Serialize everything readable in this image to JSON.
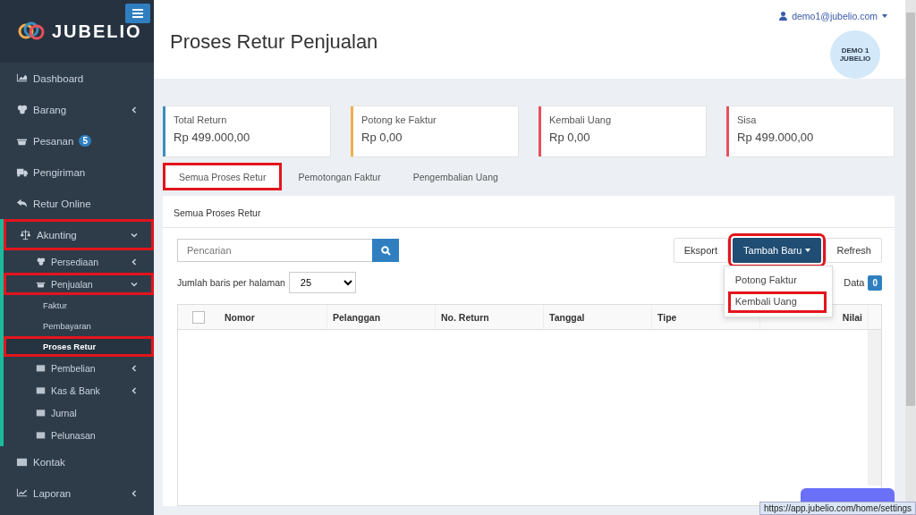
{
  "sidebar": {
    "brand": "JUBELIO",
    "items": [
      {
        "label": "Dashboard",
        "selected": false
      },
      {
        "label": "Barang",
        "selected": false,
        "expanded": false
      },
      {
        "label": "Pesanan",
        "selected": false,
        "badge": "5"
      },
      {
        "label": "Pengiriman",
        "selected": false
      },
      {
        "label": "Retur Online",
        "selected": false
      },
      {
        "label": "Akunting",
        "selected": false,
        "expanded": true,
        "highlighted": true,
        "children": [
          {
            "label": "Persediaan",
            "selected": false,
            "expanded": false
          },
          {
            "label": "Penjualan",
            "selected": false,
            "expanded": true,
            "highlighted": true,
            "children": [
              {
                "label": "Faktur",
                "selected": false
              },
              {
                "label": "Pembayaran",
                "selected": false
              },
              {
                "label": "Proses Retur",
                "selected": true,
                "highlighted": true
              }
            ]
          },
          {
            "label": "Pembelian",
            "selected": false,
            "expanded": false
          },
          {
            "label": "Kas & Bank",
            "selected": false,
            "expanded": false
          },
          {
            "label": "Jurnal",
            "selected": false
          },
          {
            "label": "Pelunasan",
            "selected": false
          }
        ]
      },
      {
        "label": "Kontak",
        "selected": false
      },
      {
        "label": "Laporan",
        "selected": false,
        "expanded": false
      }
    ]
  },
  "header": {
    "title": "Proses Retur Penjualan",
    "user": "demo1@jubelio.com",
    "avatar": "DEMO 1 JUBELIO"
  },
  "summary": [
    {
      "label": "Total Return",
      "value": "Rp 499.000,00",
      "color": "#3c8dbc"
    },
    {
      "label": "Potong ke Faktur",
      "value": "Rp 0,00",
      "color": "#f0ad4e"
    },
    {
      "label": "Kembali Uang",
      "value": "Rp 0,00",
      "color": "#e8505b"
    },
    {
      "label": "Sisa",
      "value": "Rp 499.000,00",
      "color": "#e8505b"
    }
  ],
  "tabs": [
    {
      "label": "Semua Proses Retur",
      "selected": true,
      "highlighted": true
    },
    {
      "label": "Pemotongan Faktur",
      "selected": false,
      "highlighted": false
    },
    {
      "label": "Pengembalian Uang",
      "selected": false,
      "highlighted": false
    }
  ],
  "panel": {
    "title": "Semua Proses Retur",
    "search": {
      "placeholder": "Pencarian"
    },
    "buttons": [
      {
        "label": "Eksport",
        "kind": "plain",
        "highlighted": false
      },
      {
        "label": "Tambah Baru",
        "kind": "dropdown",
        "highlighted": true
      },
      {
        "label": "Refresh",
        "kind": "plain",
        "highlighted": false
      }
    ],
    "menu": [
      {
        "label": "Potong Faktur",
        "highlighted": false
      },
      {
        "label": "Kembali Uang",
        "highlighted": true
      }
    ],
    "rows_label": "Jumlah baris per halaman",
    "page_size": "25",
    "data_label": "Data",
    "data_count": "0",
    "table": {
      "select_all": {
        "checked": false
      },
      "columns": [
        "Nomor",
        "Pelanggan",
        "No. Return",
        "Tanggal",
        "Tipe",
        "Nilai"
      ]
    }
  },
  "status_url": "https://app.jubelio.com/home/settings"
}
